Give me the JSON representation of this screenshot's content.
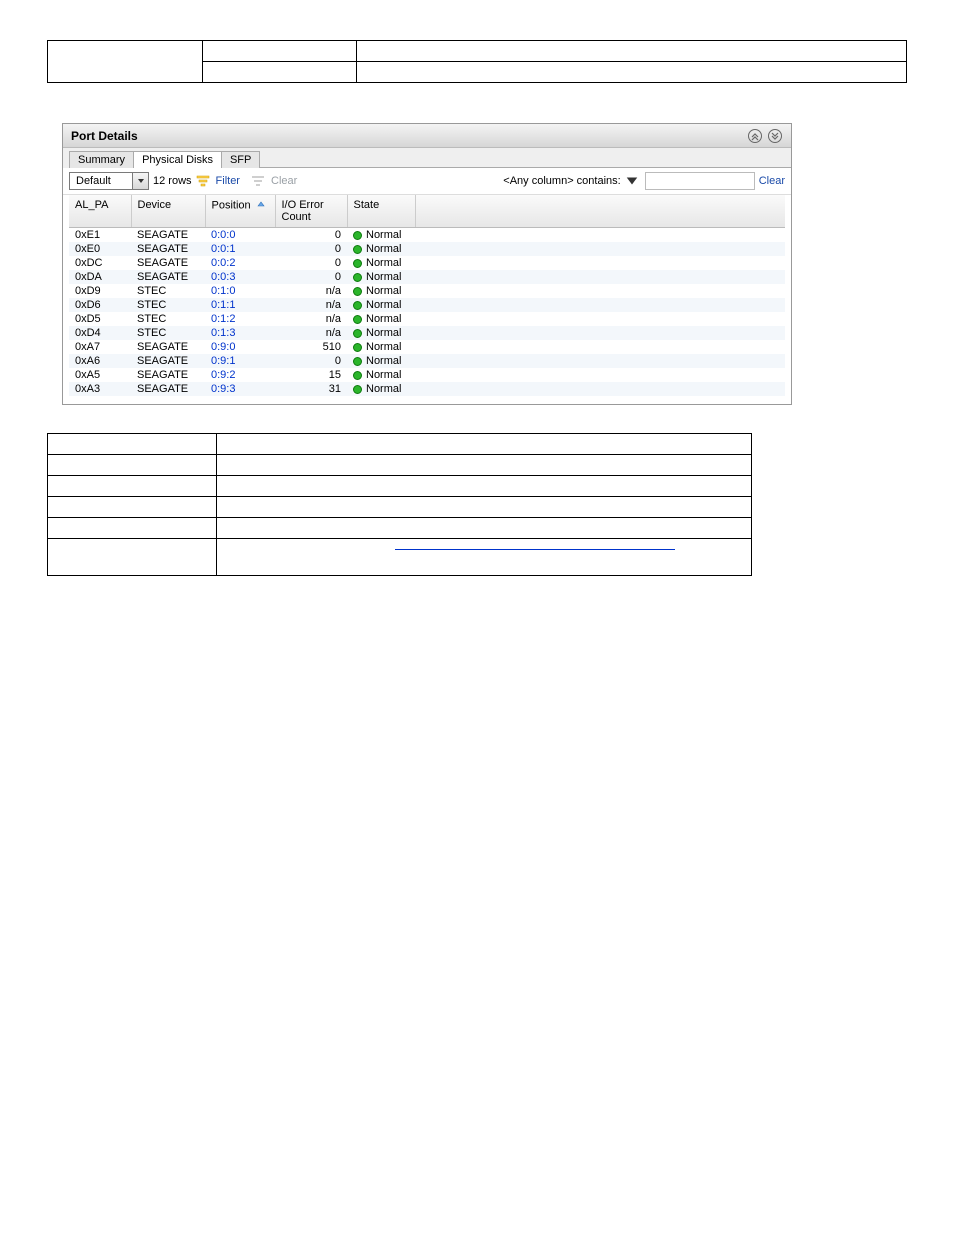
{
  "upperTable": {
    "rows": [
      {
        "c0": "",
        "c1": "",
        "c2": ""
      },
      {
        "c0": "",
        "c1": "",
        "c2": ""
      }
    ]
  },
  "panel": {
    "title": "Port Details",
    "tabs": [
      "Summary",
      "Physical Disks",
      "SFP"
    ],
    "activeTab": 1,
    "toolbar": {
      "viewSelect": "Default",
      "rowCount": "12 rows",
      "filterLabel": "Filter",
      "clearLabel": "Clear",
      "searchScope": "<Any column> contains:",
      "searchValue": "",
      "clearSearchLabel": "Clear"
    },
    "columns": [
      "AL_PA",
      "Device",
      "Position",
      "I/O Error Count",
      "State"
    ],
    "sortColumn": 2,
    "sortDir": "asc",
    "stateLabel": "Normal",
    "rows": [
      {
        "al": "0xE1",
        "dev": "SEAGATE",
        "pos": "0:0:0",
        "io": "0",
        "state": "Normal"
      },
      {
        "al": "0xE0",
        "dev": "SEAGATE",
        "pos": "0:0:1",
        "io": "0",
        "state": "Normal"
      },
      {
        "al": "0xDC",
        "dev": "SEAGATE",
        "pos": "0:0:2",
        "io": "0",
        "state": "Normal"
      },
      {
        "al": "0xDA",
        "dev": "SEAGATE",
        "pos": "0:0:3",
        "io": "0",
        "state": "Normal"
      },
      {
        "al": "0xD9",
        "dev": "STEC",
        "pos": "0:1:0",
        "io": "n/a",
        "state": "Normal"
      },
      {
        "al": "0xD6",
        "dev": "STEC",
        "pos": "0:1:1",
        "io": "n/a",
        "state": "Normal"
      },
      {
        "al": "0xD5",
        "dev": "STEC",
        "pos": "0:1:2",
        "io": "n/a",
        "state": "Normal"
      },
      {
        "al": "0xD4",
        "dev": "STEC",
        "pos": "0:1:3",
        "io": "n/a",
        "state": "Normal"
      },
      {
        "al": "0xA7",
        "dev": "SEAGATE",
        "pos": "0:9:0",
        "io": "510",
        "state": "Normal"
      },
      {
        "al": "0xA6",
        "dev": "SEAGATE",
        "pos": "0:9:1",
        "io": "0",
        "state": "Normal"
      },
      {
        "al": "0xA5",
        "dev": "SEAGATE",
        "pos": "0:9:2",
        "io": "15",
        "state": "Normal"
      },
      {
        "al": "0xA3",
        "dev": "SEAGATE",
        "pos": "0:9:3",
        "io": "31",
        "state": "Normal"
      }
    ]
  },
  "lowerTable": {
    "rows": [
      {
        "c0": "",
        "c1": ""
      },
      {
        "c0": "",
        "c1": ""
      },
      {
        "c0": "",
        "c1": ""
      },
      {
        "c0": "",
        "c1": ""
      },
      {
        "c0": "",
        "c1": ""
      },
      {
        "c0": "",
        "c1": ""
      }
    ]
  }
}
